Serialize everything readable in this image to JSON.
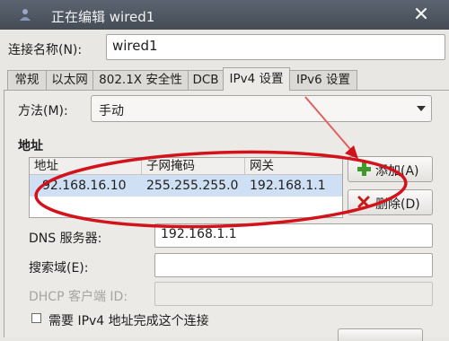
{
  "window": {
    "title": "正在编辑 wired1"
  },
  "connection_name": {
    "label": "连接名称(N):",
    "value": "wired1"
  },
  "tabs": [
    {
      "label": "常规"
    },
    {
      "label": "以太网"
    },
    {
      "label": "802.1X 安全性"
    },
    {
      "label": "DCB"
    },
    {
      "label": "IPv4 设置",
      "active": true
    },
    {
      "label": "IPv6 设置"
    }
  ],
  "ipv4": {
    "method_label": "方法(M):",
    "method_value": "手动",
    "address_section_label": "地址",
    "columns": [
      "地址",
      "子网掩码",
      "网关"
    ],
    "rows": [
      {
        "address": "92.168.16.10",
        "netmask": "255.255.255.0",
        "gateway": "192.168.1.1"
      }
    ],
    "add_button": "添加(A)",
    "delete_button": "删除(D)",
    "dns_label": "DNS 服务器:",
    "dns_value": "192.168.1.1",
    "search_domain_label": "搜索域(E):",
    "search_domain_value": "",
    "dhcp_client_id_label": "DHCP 客户端 ID:",
    "dhcp_client_id_value": "",
    "require_ipv4_label": "需要 IPv4 地址完成这个连接",
    "require_ipv4_checked": false
  },
  "colors": {
    "annotation_red": "#d3131b",
    "selection": "#cfe0f5",
    "add_icon_green": "#3f9a2e",
    "delete_icon_red": "#c41a1a"
  },
  "icons": [
    "network-app-icon",
    "close-icon",
    "dropdown-arrow-icon",
    "plus-icon",
    "x-icon",
    "checkbox-icon"
  ]
}
